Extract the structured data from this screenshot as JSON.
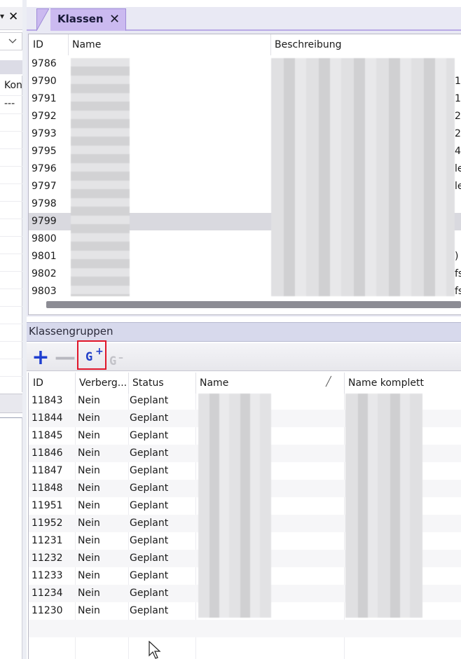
{
  "left": {
    "close_symbol": "✕",
    "arrow_symbol": "▾",
    "dropdown_chevron": "chevron-down-icon",
    "column_label": "Kon",
    "placeholder": "---"
  },
  "klassen": {
    "tab_title": "Klassen",
    "tab_close": "✕",
    "columns": {
      "id": "ID",
      "name": "Name",
      "beschreibung": "Beschreibung"
    },
    "rows": [
      {
        "id": "9786",
        "trail": ""
      },
      {
        "id": "9790",
        "trail": "1"
      },
      {
        "id": "9791",
        "trail": "1"
      },
      {
        "id": "9792",
        "trail": "2"
      },
      {
        "id": "9793",
        "trail": "2"
      },
      {
        "id": "9795",
        "trail": "4"
      },
      {
        "id": "9796",
        "trail": "le"
      },
      {
        "id": "9797",
        "trail": "le"
      },
      {
        "id": "9798",
        "trail": ""
      },
      {
        "id": "9799",
        "trail": ""
      },
      {
        "id": "9800",
        "trail": ""
      },
      {
        "id": "9801",
        "trail": ")"
      },
      {
        "id": "9802",
        "trail": "fs"
      },
      {
        "id": "9803",
        "trail": "fs"
      }
    ],
    "selected_row": "9799"
  },
  "klassengruppen": {
    "title": "Klassengruppen",
    "toolbar": {
      "add": "+",
      "remove": "—",
      "group_add_g": "G",
      "group_add_sign": "+",
      "group_remove_g": "G",
      "group_remove_sign": "–"
    },
    "columns": {
      "id": "ID",
      "verborgen": "Verberg...",
      "status": "Status",
      "name": "Name",
      "name_komplett": "Name komplett"
    },
    "sort_indicator": "╱",
    "rows": [
      {
        "id": "11843",
        "verborgen": "Nein",
        "status": "Geplant"
      },
      {
        "id": "11844",
        "verborgen": "Nein",
        "status": "Geplant"
      },
      {
        "id": "11845",
        "verborgen": "Nein",
        "status": "Geplant"
      },
      {
        "id": "11846",
        "verborgen": "Nein",
        "status": "Geplant"
      },
      {
        "id": "11847",
        "verborgen": "Nein",
        "status": "Geplant"
      },
      {
        "id": "11848",
        "verborgen": "Nein",
        "status": "Geplant"
      },
      {
        "id": "11951",
        "verborgen": "Nein",
        "status": "Geplant"
      },
      {
        "id": "11952",
        "verborgen": "Nein",
        "status": "Geplant"
      },
      {
        "id": "11231",
        "verborgen": "Nein",
        "status": "Geplant"
      },
      {
        "id": "11232",
        "verborgen": "Nein",
        "status": "Geplant"
      },
      {
        "id": "11233",
        "verborgen": "Nein",
        "status": "Geplant"
      },
      {
        "id": "11234",
        "verborgen": "Nein",
        "status": "Geplant"
      },
      {
        "id": "11230",
        "verborgen": "Nein",
        "status": "Geplant"
      }
    ]
  }
}
